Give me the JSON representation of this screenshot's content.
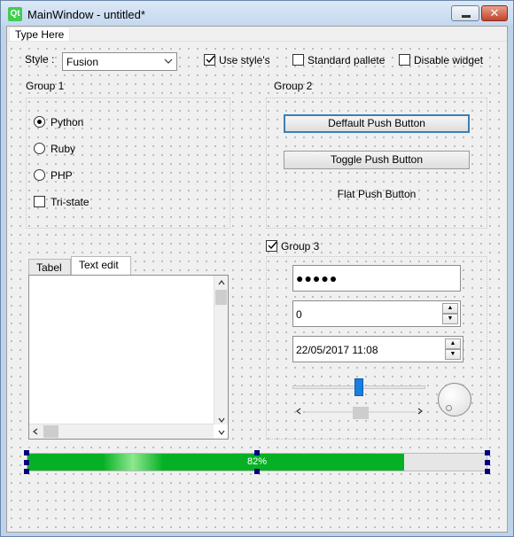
{
  "window": {
    "title": "MainWindow - untitled*",
    "logo_text": "Qt",
    "close_glyph": "✕"
  },
  "menubar": {
    "items": [
      {
        "label": "Type Here"
      }
    ]
  },
  "style_row": {
    "style_label": "Style :",
    "style_value": "Fusion",
    "use_styles_label": "Use style's",
    "use_styles_checked": true,
    "standard_palette_label": "Standard pallete",
    "standard_palette_checked": false,
    "disable_widget_label": "Disable widget",
    "disable_widget_checked": false
  },
  "group1": {
    "title": "Group 1",
    "radios": [
      {
        "label": "Python",
        "checked": true
      },
      {
        "label": "Ruby",
        "checked": false
      },
      {
        "label": "PHP",
        "checked": false
      }
    ],
    "tristate_label": "Tri-state",
    "tristate_checked": false
  },
  "group2": {
    "title": "Group 2",
    "default_button": "Deffault Push Button",
    "toggle_button": "Toggle Push Button",
    "flat_button": "Flat Push Button"
  },
  "tabs": {
    "items": [
      {
        "label": "Tabel"
      },
      {
        "label": "Text edit"
      }
    ],
    "active": "Text edit"
  },
  "group3": {
    "title": "Group 3",
    "checked": true,
    "password_value": "●●●●●",
    "spinbox_value": "0",
    "datetime_value": "22/05/2017 11:08",
    "horizontal_slider_value": 0.5,
    "horizontal_scrollbar_value": 0.5
  },
  "progress": {
    "value": 82,
    "text": "82%"
  },
  "colors": {
    "progress_fill": "#06b025",
    "slider_handle": "#1a7ee0",
    "default_button_border": "#3c7fb1"
  },
  "icons": {
    "combo_arrow": "chevron-down-icon",
    "spin_up": "arrow-up-icon",
    "spin_down": "arrow-down-icon",
    "check": "checkmark-icon"
  }
}
